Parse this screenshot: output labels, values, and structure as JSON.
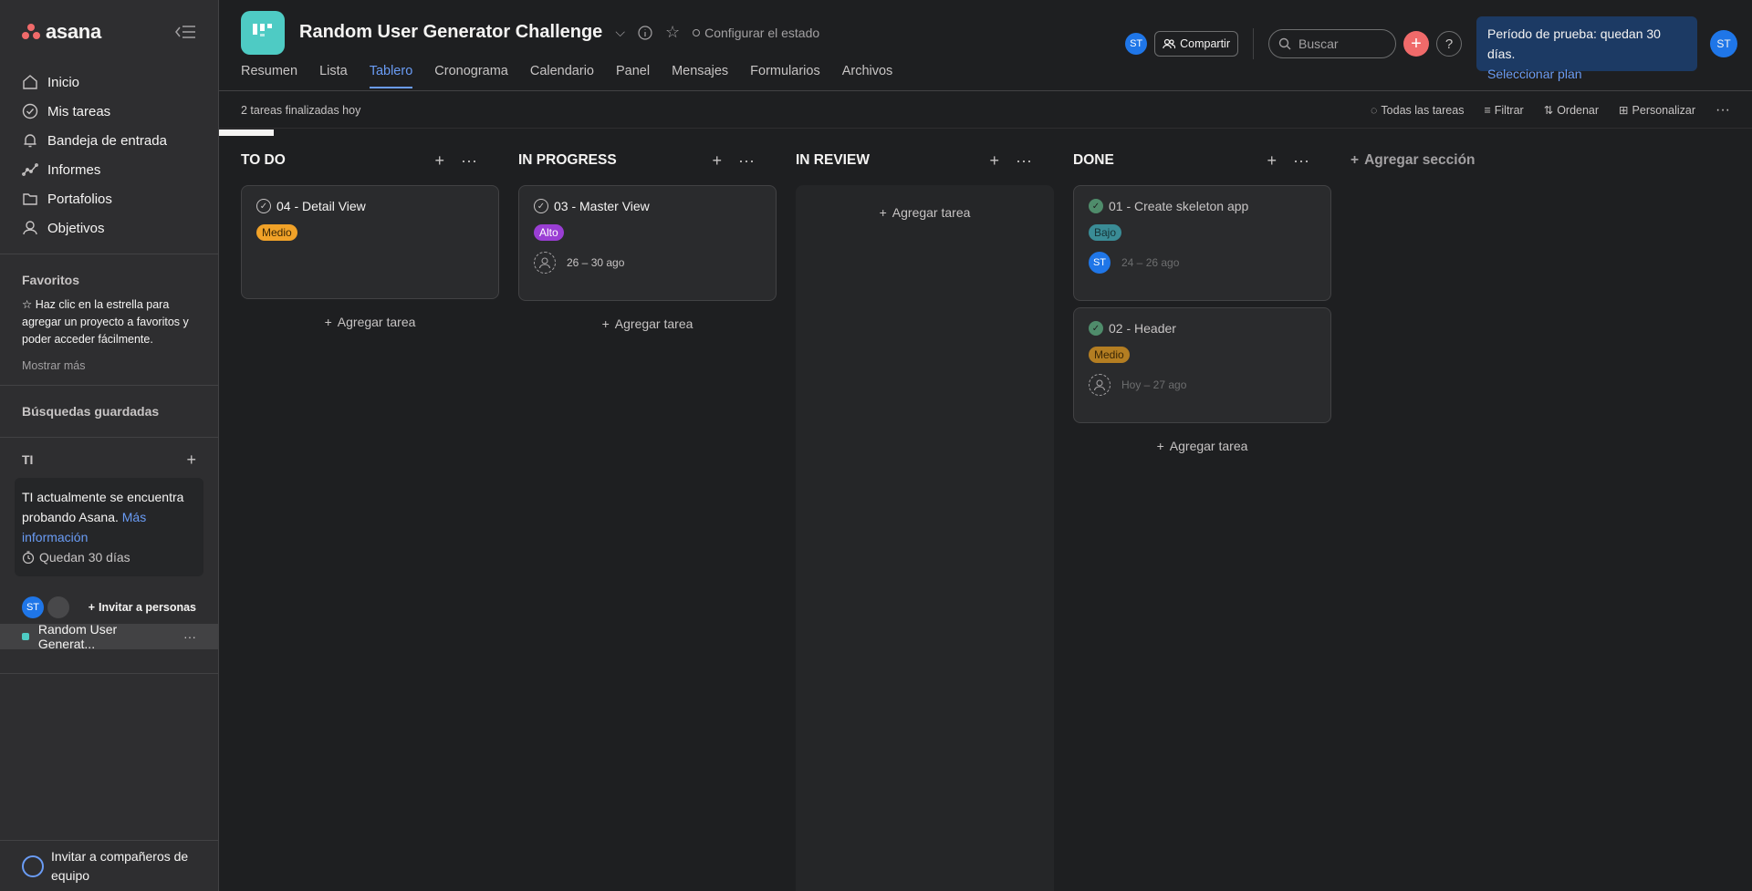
{
  "sidebar": {
    "logo": "asana",
    "nav": [
      {
        "label": "Inicio",
        "icon": "home-icon"
      },
      {
        "label": "Mis tareas",
        "icon": "check-circle-icon"
      },
      {
        "label": "Bandeja de entrada",
        "icon": "bell-icon"
      },
      {
        "label": "Informes",
        "icon": "chart-line-icon"
      },
      {
        "label": "Portafolios",
        "icon": "folder-icon"
      },
      {
        "label": "Objetivos",
        "icon": "person-icon"
      }
    ],
    "favorites_title": "Favoritos",
    "favorites_hint": "Haz clic en la estrella para agregar un proyecto a favoritos y poder acceder fácilmente.",
    "show_more": "Mostrar más",
    "saved_searches": "Búsquedas guardadas",
    "team_title": "TI",
    "trial_text": "TI actualmente se encuentra probando Asana.",
    "trial_link": "Más información",
    "trial_days": "Quedan 30 días",
    "member_initials": "ST",
    "invite_people": "Invitar a personas",
    "project_name": "Random User Generat...",
    "invite_team": "Invitar a compañeros de equipo"
  },
  "header": {
    "project_title": "Random User Generator Challenge",
    "set_status": "Configurar el estado",
    "tabs": [
      "Resumen",
      "Lista",
      "Tablero",
      "Cronograma",
      "Calendario",
      "Panel",
      "Mensajes",
      "Formularios",
      "Archivos"
    ],
    "active_tab": "Tablero",
    "avatar_initials": "ST",
    "share_label": "Compartir",
    "search_placeholder": "Buscar",
    "help": "?",
    "trial_banner_title": "Período de prueba: quedan 30 días.",
    "trial_banner_link": "Seleccionar plan",
    "user_initials": "ST"
  },
  "toolbar": {
    "completed": "2 tareas finalizadas hoy",
    "all_tasks": "Todas las tareas",
    "filter": "Filtrar",
    "sort": "Ordenar",
    "customize": "Personalizar"
  },
  "board": {
    "add_task": "Agregar tarea",
    "add_section": "Agregar sección",
    "columns": [
      {
        "title": "TO DO",
        "cards": [
          {
            "title": "04 - Detail View",
            "tag": "Medio"
          }
        ]
      },
      {
        "title": "IN PROGRESS",
        "cards": [
          {
            "title": "03 - Master View",
            "tag": "Alto",
            "dates": "26 – 30 ago"
          }
        ]
      },
      {
        "title": "IN REVIEW",
        "cards": []
      },
      {
        "title": "DONE",
        "cards": [
          {
            "title": "01 - Create skeleton app",
            "tag": "Bajo",
            "assignee": "ST",
            "dates": "24 – 26 ago"
          },
          {
            "title": "02 - Header",
            "tag": "Medio",
            "dates": "Hoy – 27 ago"
          }
        ]
      }
    ]
  },
  "colors": {
    "accent": "#6a9cf5",
    "brand_coral": "#f06a6a",
    "project_icon": "#4ecbc4",
    "tag_medio": "#f1a228",
    "tag_alto": "#9a3ed4",
    "tag_bajo": "#3a8c96"
  }
}
